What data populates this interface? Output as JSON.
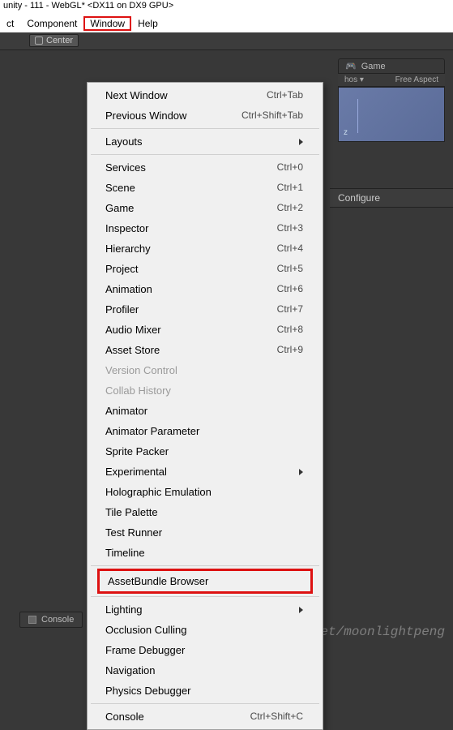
{
  "title": "unity - 111 - WebGL* <DX11 on DX9 GPU>",
  "menubar": {
    "items_left": [
      "ct",
      "Component"
    ],
    "active": "Window",
    "items_right": [
      "Help"
    ]
  },
  "toolbar": {
    "center": "Center"
  },
  "game": {
    "label": "Game",
    "aspect_prefix": "hos ▾",
    "aspect": "Free Aspect",
    "axis": "z"
  },
  "configure_label": "Configure",
  "dropdown": {
    "next_window": {
      "label": "Next Window",
      "shortcut": "Ctrl+Tab"
    },
    "prev_window": {
      "label": "Previous Window",
      "shortcut": "Ctrl+Shift+Tab"
    },
    "layouts": {
      "label": "Layouts"
    },
    "services": {
      "label": "Services",
      "shortcut": "Ctrl+0"
    },
    "scene": {
      "label": "Scene",
      "shortcut": "Ctrl+1"
    },
    "game": {
      "label": "Game",
      "shortcut": "Ctrl+2"
    },
    "inspector": {
      "label": "Inspector",
      "shortcut": "Ctrl+3"
    },
    "hierarchy": {
      "label": "Hierarchy",
      "shortcut": "Ctrl+4"
    },
    "project": {
      "label": "Project",
      "shortcut": "Ctrl+5"
    },
    "animation": {
      "label": "Animation",
      "shortcut": "Ctrl+6"
    },
    "profiler": {
      "label": "Profiler",
      "shortcut": "Ctrl+7"
    },
    "audio_mixer": {
      "label": "Audio Mixer",
      "shortcut": "Ctrl+8"
    },
    "asset_store": {
      "label": "Asset Store",
      "shortcut": "Ctrl+9"
    },
    "version_control": {
      "label": "Version Control"
    },
    "collab_history": {
      "label": "Collab History"
    },
    "animator": {
      "label": "Animator"
    },
    "animator_parameter": {
      "label": "Animator Parameter"
    },
    "sprite_packer": {
      "label": "Sprite Packer"
    },
    "experimental": {
      "label": "Experimental"
    },
    "holographic": {
      "label": "Holographic Emulation"
    },
    "tile_palette": {
      "label": "Tile Palette"
    },
    "test_runner": {
      "label": "Test Runner"
    },
    "timeline": {
      "label": "Timeline"
    },
    "assetbundle": {
      "label": "AssetBundle Browser"
    },
    "lighting": {
      "label": "Lighting"
    },
    "occlusion": {
      "label": "Occlusion Culling"
    },
    "frame_debugger": {
      "label": "Frame Debugger"
    },
    "navigation": {
      "label": "Navigation"
    },
    "physics_debugger": {
      "label": "Physics Debugger"
    },
    "console": {
      "label": "Console",
      "shortcut": "Ctrl+Shift+C"
    }
  },
  "console_tab": "Console",
  "watermark": "https://blog.csdn.net/moonlightpeng"
}
